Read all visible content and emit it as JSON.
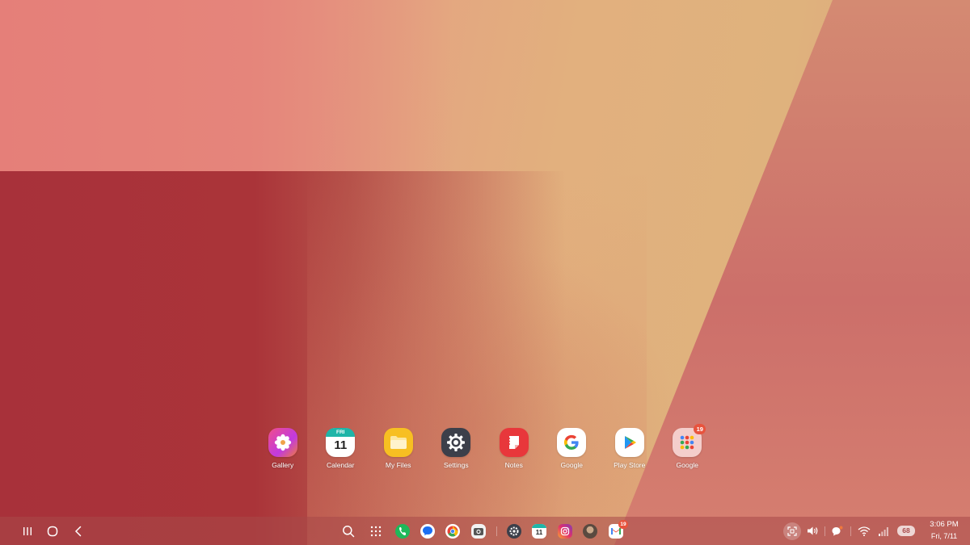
{
  "dock": {
    "apps": [
      {
        "label": "Gallery"
      },
      {
        "label": "Calendar",
        "icon_day": "FRI",
        "icon_date": "11"
      },
      {
        "label": "My Files"
      },
      {
        "label": "Settings"
      },
      {
        "label": "Notes"
      },
      {
        "label": "Google"
      },
      {
        "label": "Play Store"
      },
      {
        "label": "Google",
        "badge": "19"
      }
    ]
  },
  "taskbar": {
    "pinned": {
      "calendar_date": "11",
      "gmail_badge": "19"
    },
    "battery": "68",
    "clock": {
      "time": "3:06 PM",
      "date": "Fri, 7/11"
    }
  },
  "colors": {
    "taskbar": "#a84848",
    "badge": "#e8533d",
    "calendar_header": "#1fb5a8"
  }
}
